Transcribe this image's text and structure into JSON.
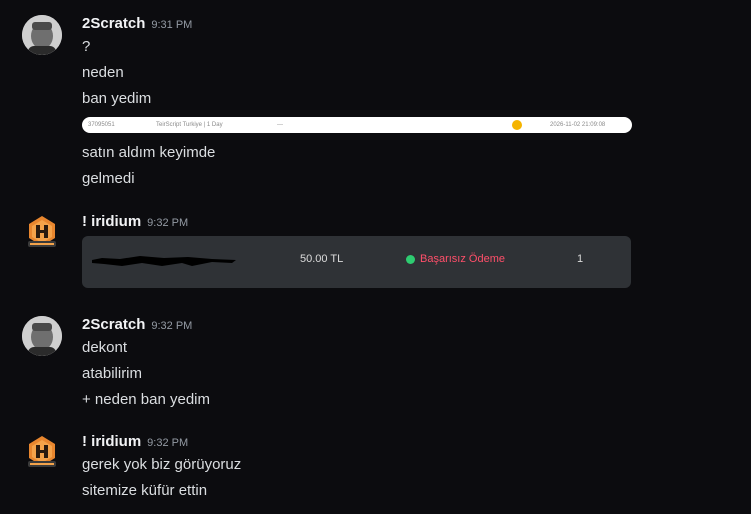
{
  "messages": [
    {
      "username": "2Scratch",
      "time": "9:31 PM",
      "lines": [
        "?",
        "neden",
        "ban yedim"
      ],
      "order_strip": {
        "id": "37095051",
        "product": "TeirScript Turkiye | 1 Day",
        "dash": "---",
        "date": "2026-11-02 21:09:08"
      },
      "lines_after": [
        "satın aldım keyimde",
        "gelmedi"
      ]
    },
    {
      "username": "! iridium",
      "time": "9:32 PM",
      "payment_card": {
        "amount": "50.00 TL",
        "status": "Başarısız Ödeme",
        "quantity": "1"
      }
    },
    {
      "username": "2Scratch",
      "time": "9:32 PM",
      "lines": [
        "dekont",
        "atabilirim",
        "+ neden ban yedim"
      ]
    },
    {
      "username": "! iridium",
      "time": "9:32 PM",
      "lines": [
        "gerek yok biz görüyoruz",
        "sitemize küfür ettin"
      ]
    }
  ],
  "colors": {
    "background": "#0c0c0f",
    "status_failed": "#ff4f6a",
    "status_dot": "#2ecc71",
    "pending_icon": "#f5b400"
  },
  "icons": [
    "user-avatar-icon",
    "brand-logo-avatar-icon",
    "pending-status-icon",
    "status-dot-icon"
  ]
}
